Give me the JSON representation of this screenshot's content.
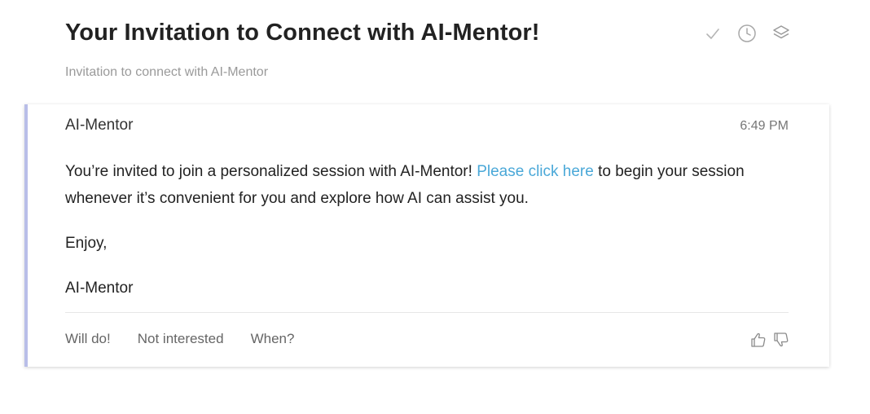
{
  "email": {
    "subject": "Your Invitation to Connect with AI-Mentor!",
    "preview": "Invitation to connect with AI-Mentor"
  },
  "header_actions": {
    "icons": [
      "check-icon",
      "clock-icon",
      "layers-icon"
    ]
  },
  "message": {
    "sender": "AI-Mentor",
    "time": "6:49 PM",
    "body_before_link": "You’re invited to join a personalized session with AI-Mentor! ",
    "link_text": "Please click here",
    "body_after_link": " to begin your session whenever it’s convenient for you and explore how AI can assist you.",
    "closing": "Enjoy,",
    "signature": "AI-Mentor"
  },
  "quick_replies": [
    "Will do!",
    "Not interested",
    "When?"
  ],
  "feedback": {
    "icons": [
      "thumbs-up-icon",
      "thumbs-down-icon"
    ]
  },
  "colors": {
    "accent_bar": "#b9bee8",
    "link": "#4aa8d8"
  }
}
